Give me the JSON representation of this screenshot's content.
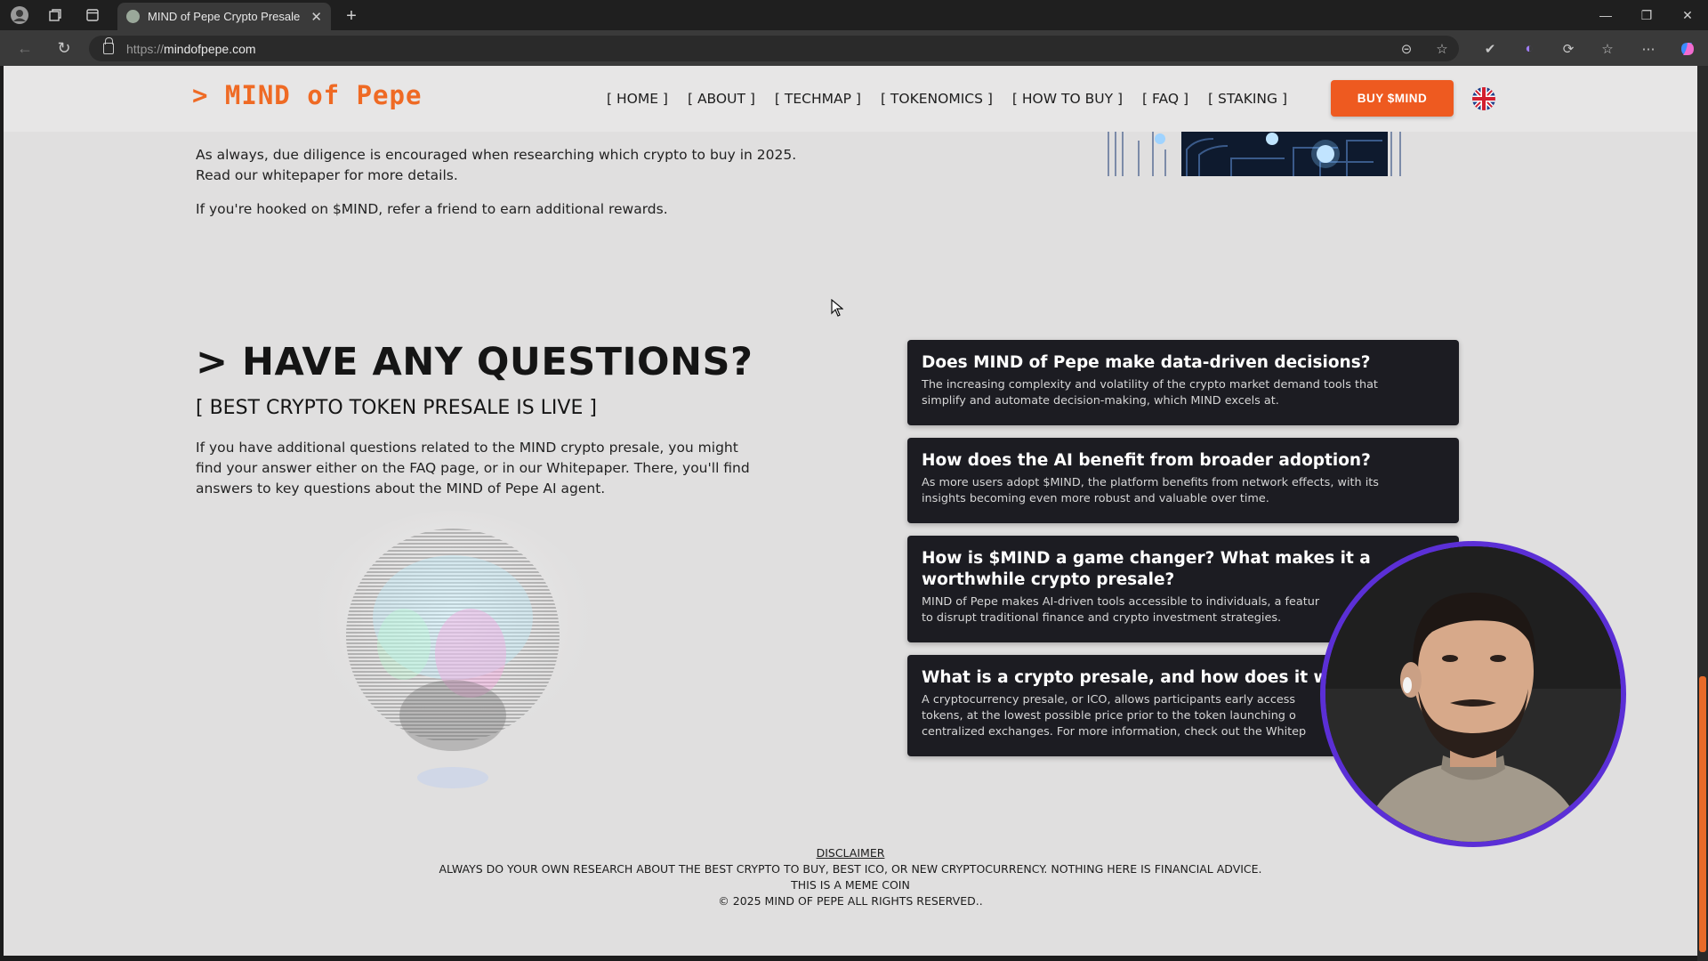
{
  "browser": {
    "tab_title": "MIND of Pepe Crypto Presale | Ev",
    "url_protocol": "https://",
    "url_host": "mindofpepe.com"
  },
  "header": {
    "logo": "> MIND of Pepe",
    "nav": [
      "[ HOME ]",
      "[ ABOUT ]",
      "[ TECHMAP ]",
      "[ TOKENOMICS ]",
      "[ HOW TO BUY ]",
      "[ FAQ ]",
      "[ STAKING ]"
    ],
    "buy_button": "BUY $MIND",
    "language": "English (UK flag)"
  },
  "intro": {
    "line1": "As always, due diligence is encouraged when researching which crypto to buy in 2025.",
    "line2": "Read our whitepaper for more details.",
    "line3": "If you're hooked on $MIND, refer a friend to earn additional rewards."
  },
  "questions": {
    "heading": "> HAVE ANY QUESTIONS?",
    "subheading": "[ BEST CRYPTO TOKEN PRESALE IS LIVE ]",
    "body_line1": "If you have additional questions related to the MIND crypto presale, you might",
    "body_line2": "find your answer either on the FAQ page, or in our Whitepaper. There, you'll find",
    "body_line3": "answers to key questions about the MIND of Pepe AI agent."
  },
  "faq": [
    {
      "question": "Does MIND of Pepe make data-driven decisions?",
      "answer_line1": "The increasing complexity and volatility of the crypto market demand tools that",
      "answer_line2": "simplify and automate decision-making, which MIND excels at."
    },
    {
      "question": "How does the AI benefit from broader adoption?",
      "answer_line1": "As more users adopt $MIND, the platform benefits from network effects, with its",
      "answer_line2": "insights becoming even more robust and valuable over time."
    },
    {
      "question_line1": "How is $MIND a game changer? What makes it a",
      "question_line2": "worthwhile crypto presale?",
      "answer_line1": "MIND of Pepe makes AI-driven tools accessible to individuals, a featur",
      "answer_line2": "to disrupt traditional finance and crypto investment strategies."
    },
    {
      "question": "What is a crypto presale, and how does it wor",
      "answer_line1": "A cryptocurrency presale, or ICO, allows participants early access",
      "answer_line2": "tokens, at the lowest possible price prior to the token launching o",
      "answer_line3": "centralized exchanges. For more information, check out the Whitep"
    }
  ],
  "footer": {
    "disclaimer": "DISCLAIMER",
    "line1": "ALWAYS DO YOUR OWN RESEARCH ABOUT THE BEST CRYPTO TO BUY, BEST ICO, OR NEW CRYPTOCURRENCY. NOTHING HERE IS FINANCIAL ADVICE.",
    "line2": "THIS IS A MEME COIN",
    "line3": "© 2025 MIND OF PEPE ALL RIGHTS RESERVED.."
  },
  "colors": {
    "accent": "#ee5a20",
    "page_bg": "#e0dfdf",
    "faq_card": "#1c1c22",
    "webcam_ring": "#5b2fd6"
  }
}
